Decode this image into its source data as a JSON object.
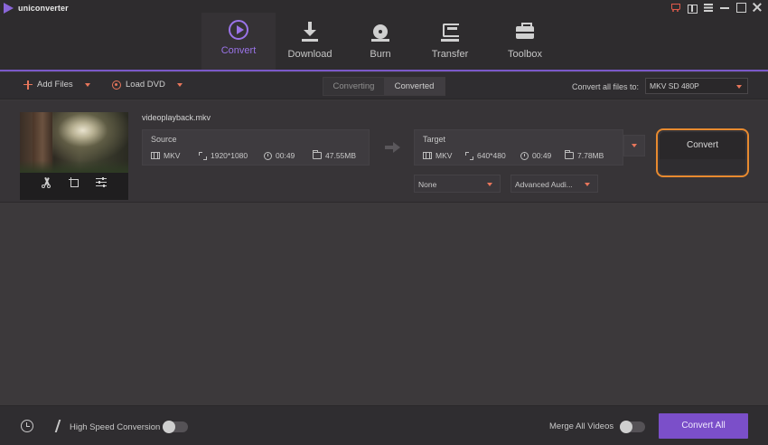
{
  "app": {
    "title": "uniconverter"
  },
  "nav": {
    "tabs": [
      {
        "label": "Convert",
        "icon": "play-circle-icon",
        "active": true
      },
      {
        "label": "Download",
        "icon": "download-icon"
      },
      {
        "label": "Burn",
        "icon": "burn-disc-icon"
      },
      {
        "label": "Transfer",
        "icon": "transfer-icon"
      },
      {
        "label": "Toolbox",
        "icon": "toolbox-icon"
      }
    ]
  },
  "toolbar": {
    "add_files": "Add Files",
    "load_dvd": "Load DVD",
    "segment": {
      "converting": "Converting",
      "converted": "Converted",
      "selected": "Converting"
    },
    "convert_all_label": "Convert all files to:",
    "format_value": "MKV SD 480P"
  },
  "file": {
    "name": "videoplayback.mkv",
    "source": {
      "title": "Source",
      "format": "MKV",
      "resolution": "1920*1080",
      "duration": "00:49",
      "size": "47.55MB"
    },
    "target": {
      "title": "Target",
      "format": "MKV",
      "resolution": "640*480",
      "duration": "00:49",
      "size": "7.78MB"
    },
    "subtitle_select": "None",
    "audio_select": "Advanced Audi...",
    "convert_label": "Convert"
  },
  "bottom": {
    "high_speed_label": "High Speed Conversion",
    "high_speed_on": false,
    "merge_label": "Merge All Videos",
    "merge_on": false,
    "convert_all_label": "Convert All"
  },
  "colors": {
    "accent": "#7b4fc9",
    "active_tab": "#9a73e8",
    "highlight": "#e88a2f",
    "orange_icon": "#e8765b"
  }
}
